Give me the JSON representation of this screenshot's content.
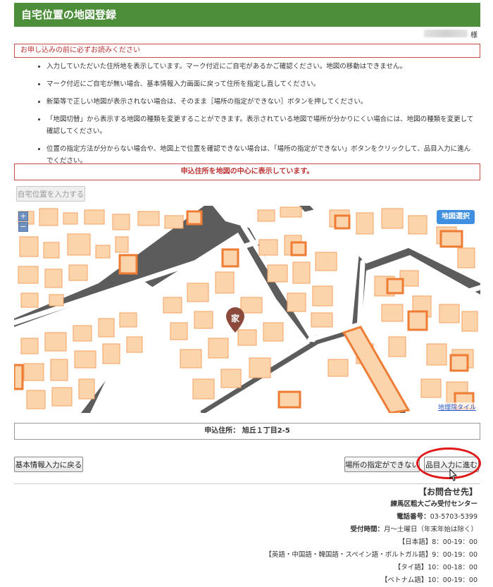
{
  "header": {
    "title": "自宅位置の地図登録"
  },
  "user": {
    "suffix": "様"
  },
  "notice": {
    "heading": "お申し込みの前に必ずお読みください",
    "items": [
      "入力していただいた住所地を表示しています。マーク付近にご自宅があるかご確認ください。地図の移動はできません。",
      "マーク付近にご自宅が無い場合、基本情報入力画面に戻って住所を指定し直してください。",
      "新築等で正しい地図が表示されない場合は、そのまま［場所の指定ができない］ボタンを押してください。",
      "「地図切替」から表示する地図の種類を変更することができます。表示されている地図で場所が分かりにくい場合には、地図の種類を変更して確認してください。",
      "位置の指定方法が分からない場合や、地図上で位置を確認できない場合は、「場所の指定ができない」ボタンをクリックして、品目入力に進んでください。"
    ]
  },
  "center_message": "申込住所を地図の中心に表示しています。",
  "buttons": {
    "input_home_location": "自宅位置を入力する",
    "back_to_basic_info": "基本情報入力に戻る",
    "cannot_specify_location": "場所の指定ができない",
    "proceed_to_item_input": "品目入力に進む"
  },
  "map": {
    "zoom_in": "+",
    "zoom_out": "−",
    "map_select": "地図選択",
    "credit": "地理院タイル",
    "marker_label": "家",
    "marker_icon": "house-marker-icon",
    "colors": {
      "building_fill": "#fbd4ac",
      "building_stroke": "#f2a262",
      "outlined_building": "#ee7c34",
      "road_edge": "#5c5c5c",
      "road": "#ffffff",
      "block": "#ffffff",
      "marker": "#8b4a3c"
    }
  },
  "address": {
    "label": "申込住所：",
    "value": "旭丘１丁目2-5"
  },
  "contact": {
    "title": "【お問合せ先】",
    "center": "練馬区粗大ごみ受付センター",
    "phone_label": "電話番号：",
    "phone": "03-5703-5399",
    "hours_label": "受付時間：",
    "hours": "月～土曜日（年末年始は除く）",
    "languages": [
      "【日本語】8：00-19：00",
      "【英語・中国語・韓国語・スペイン語・ポルトガル語】9：00-19：00",
      "【タイ語】10：00-18：00",
      "【ベトナム語】10：00-19：00"
    ]
  },
  "colors": {
    "header_bg": "#4d8e3b",
    "notice_border": "#c94a4a",
    "highlight": "#e01818",
    "map_select_bg": "#3f8fe0"
  }
}
